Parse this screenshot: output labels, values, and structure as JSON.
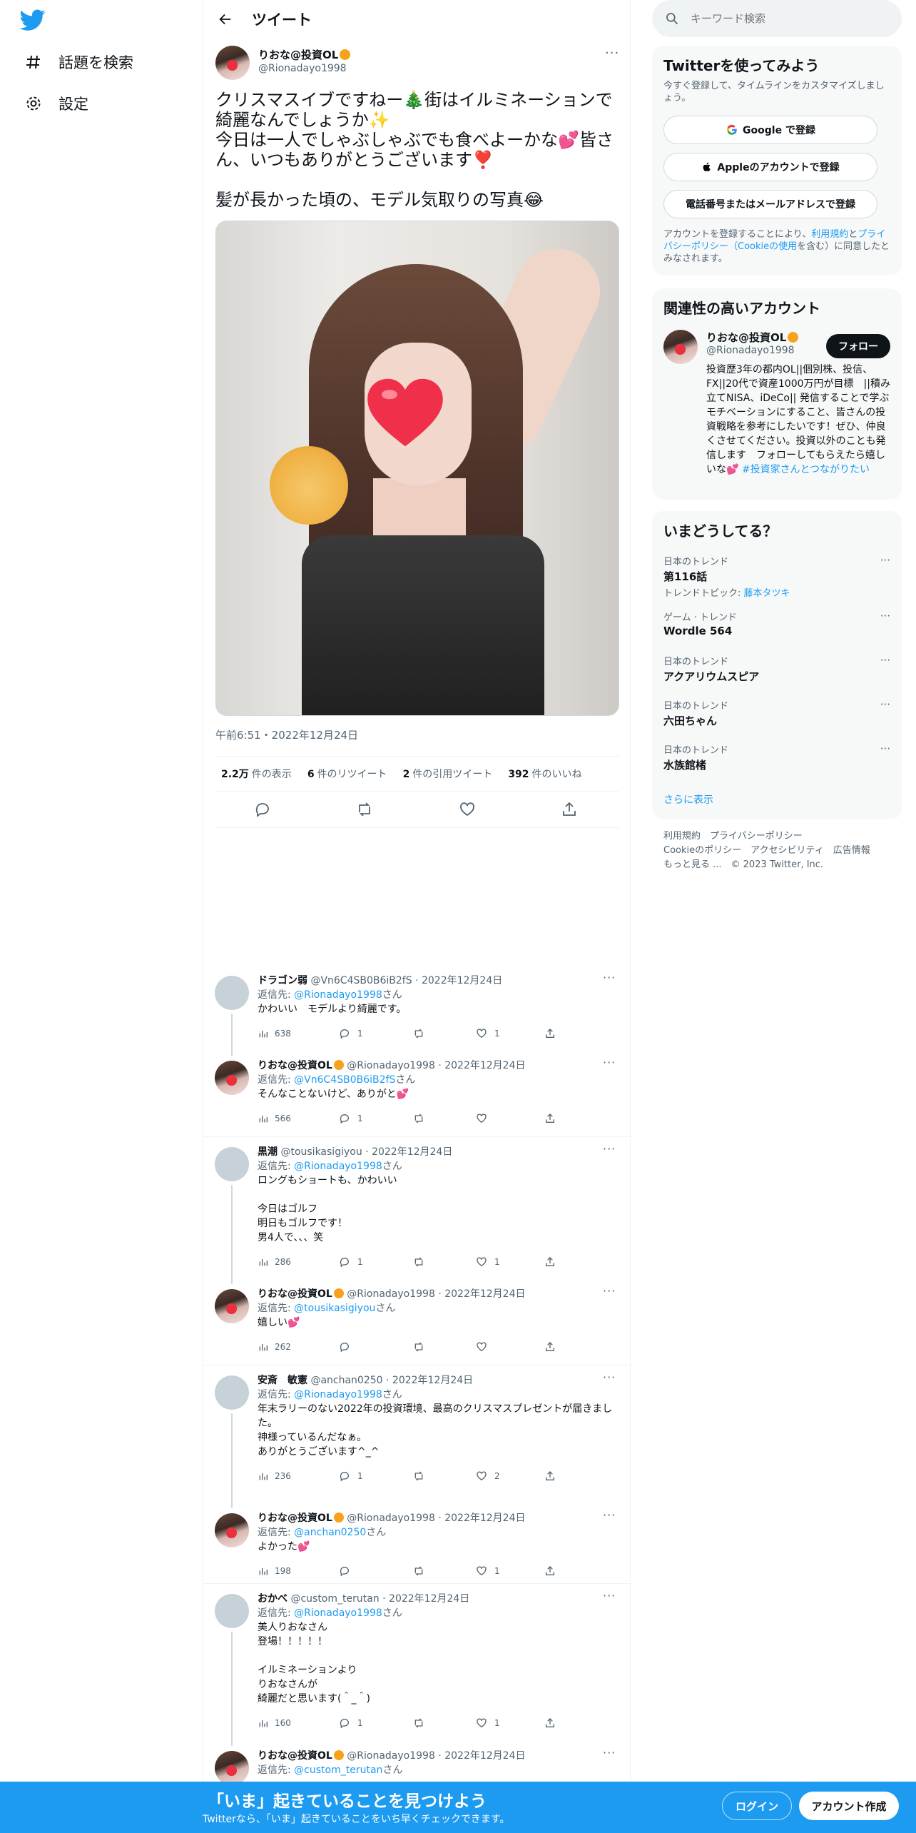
{
  "nav": {
    "explore": "話題を検索",
    "settings": "設定"
  },
  "header": {
    "title": "ツイート"
  },
  "tweet": {
    "name": "りおな@投資OL",
    "handle": "@Rionadayo1998",
    "text1": "クリスマスイブですねー🎄街はイルミネーションで綺麗なんでしょうか✨",
    "text2": "今日は一人でしゃぶしゃぶでも食べよーかな💕皆さん、いつもありがとうございます❣️",
    "text3": "髪が長かった頃の、モデル気取りの写真😂",
    "timestamp": "午前6:51・2022年12月24日",
    "views_count": "2.2万",
    "views_label": "件の表示",
    "retweets_count": "6",
    "retweets_label": "件のリツイート",
    "quotes_count": "2",
    "quotes_label": "件の引用ツイート",
    "likes_count": "392",
    "likes_label": "件のいいね"
  },
  "replies": [
    {
      "name": "ドラゴン弱",
      "handle": "@Vn6C4SB0B6iB2fS",
      "date": "2022年12月24日",
      "reply_prefix": "返信先: ",
      "reply_to": "@Rionadayo1998",
      "reply_suffix": "さん",
      "text": "かわいい　モデルより綺麗です。",
      "views": "638",
      "replies": "1",
      "retweets": "",
      "likes": "1"
    },
    {
      "name": "りおな@投資OL",
      "handle": "@Rionadayo1998",
      "date": "2022年12月24日",
      "reply_prefix": "返信先: ",
      "reply_to": "@Vn6C4SB0B6iB2fS",
      "reply_suffix": "さん",
      "text": "そんなことないけど、ありがと💕",
      "views": "566",
      "replies": "1",
      "retweets": "",
      "likes": ""
    },
    {
      "name": "黒潮",
      "handle": "@tousikasigiyou",
      "date": "2022年12月24日",
      "reply_prefix": "返信先: ",
      "reply_to": "@Rionadayo1998",
      "reply_suffix": "さん",
      "text": "ロングもショートも、かわいい\n\n今日はゴルフ\n明日もゴルフです！\n男4人で、、、笑",
      "views": "286",
      "replies": "1",
      "retweets": "",
      "likes": "1"
    },
    {
      "name": "りおな@投資OL",
      "handle": "@Rionadayo1998",
      "date": "2022年12月24日",
      "reply_prefix": "返信先: ",
      "reply_to": "@tousikasigiyou",
      "reply_suffix": "さん",
      "text": "嬉しい💕",
      "views": "262",
      "replies": "",
      "retweets": "",
      "likes": ""
    },
    {
      "name": "安斎　敏憲",
      "handle": "@anchan0250",
      "date": "2022年12月24日",
      "reply_prefix": "返信先: ",
      "reply_to": "@Rionadayo1998",
      "reply_suffix": "さん",
      "text": "年末ラリーのない2022年の投資環境、最高のクリスマスプレゼントが届きました。\n神様っているんだなぁ。\nありがとうございます^_^",
      "views": "236",
      "replies": "1",
      "retweets": "",
      "likes": "2"
    },
    {
      "name": "りおな@投資OL",
      "handle": "@Rionadayo1998",
      "date": "2022年12月24日",
      "reply_prefix": "返信先: ",
      "reply_to": "@anchan0250",
      "reply_suffix": "さん",
      "text": "よかった💕",
      "views": "198",
      "replies": "",
      "retweets": "",
      "likes": "1"
    },
    {
      "name": "おかべ",
      "handle": "@custom_terutan",
      "date": "2022年12月24日",
      "reply_prefix": "返信先: ",
      "reply_to": "@Rionadayo1998",
      "reply_suffix": "さん",
      "text": "美人りおなさん\n登場！！！！！\n\nイルミネーションより\nりおなさんが\n綺麗だと思います(＾_＾)",
      "views": "160",
      "replies": "1",
      "retweets": "",
      "likes": "1"
    },
    {
      "name": "りおな@投資OL",
      "handle": "@Rionadayo1998",
      "date": "2022年12月24日",
      "reply_prefix": "返信先: ",
      "reply_to": "@custom_terutan",
      "reply_suffix": "さん",
      "text": "",
      "views": "",
      "replies": "",
      "retweets": "",
      "likes": ""
    }
  ],
  "search": {
    "placeholder": "キーワード検索"
  },
  "signup": {
    "title": "Twitterを使ってみよう",
    "subtitle": "今すぐ登録して、タイムラインをカスタマイズしましょう。",
    "google": "Google で登録",
    "apple": "Appleのアカウントで登録",
    "phone": "電話番号またはメールアドレスで登録",
    "terms_pre": "アカウントを登録することにより、",
    "terms_link": "利用規約",
    "terms_mid": "と",
    "privacy_link": "プライバシーポリシー（Cookieの使用",
    "terms_post": "を含む）に同意したとみなされます。"
  },
  "related": {
    "title": "関連性の高いアカウント",
    "name": "りおな@投資OL",
    "handle": "@Rionadayo1998",
    "follow": "フォロー",
    "bio": "投資歴3年の都内OL||個別株、投信、FX||20代で資産1000万円が目標　||積み立てNISA、iDeCo|| 発信することで学ぶモチベーションにすること、皆さんの投資戦略を参考にしたいです！ぜひ、仲良くさせてください。投資以外のことも発信します　フォローしてもらえたら嬉しいな💕",
    "hashtag": "#投資家さんとつながりたい"
  },
  "trends": {
    "title": "いまどうしてる？",
    "items": [
      {
        "category": "日本のトレンド",
        "title": "第116話",
        "topic_label": "トレンドトピック: ",
        "topic": "藤本タツキ"
      },
      {
        "category": "ゲーム · トレンド",
        "title": "Wordle 564",
        "topic_label": "",
        "topic": ""
      },
      {
        "category": "日本のトレンド",
        "title": "アクアリウムスピア",
        "topic_label": "",
        "topic": ""
      },
      {
        "category": "日本のトレンド",
        "title": "六田ちゃん",
        "topic_label": "",
        "topic": ""
      },
      {
        "category": "日本のトレンド",
        "title": "水族館楮",
        "topic_label": "",
        "topic": ""
      }
    ],
    "show_more": "さらに表示"
  },
  "footer": {
    "line1": "利用規約　プライバシーポリシー",
    "line2": "Cookieのポリシー　アクセシビリティ　広告情報",
    "line3": "もっと見る ...　© 2023 Twitter, Inc."
  },
  "banner": {
    "title": "「いま」起きていることを見つけよう",
    "subtitle": "Twitterなら、「いま」起きていることをいち早くチェックできます。",
    "login": "ログイン",
    "signup": "アカウント作成"
  },
  "colors": {
    "accent": "#1d9bf0",
    "text": "#0f1419",
    "muted": "#536471"
  }
}
